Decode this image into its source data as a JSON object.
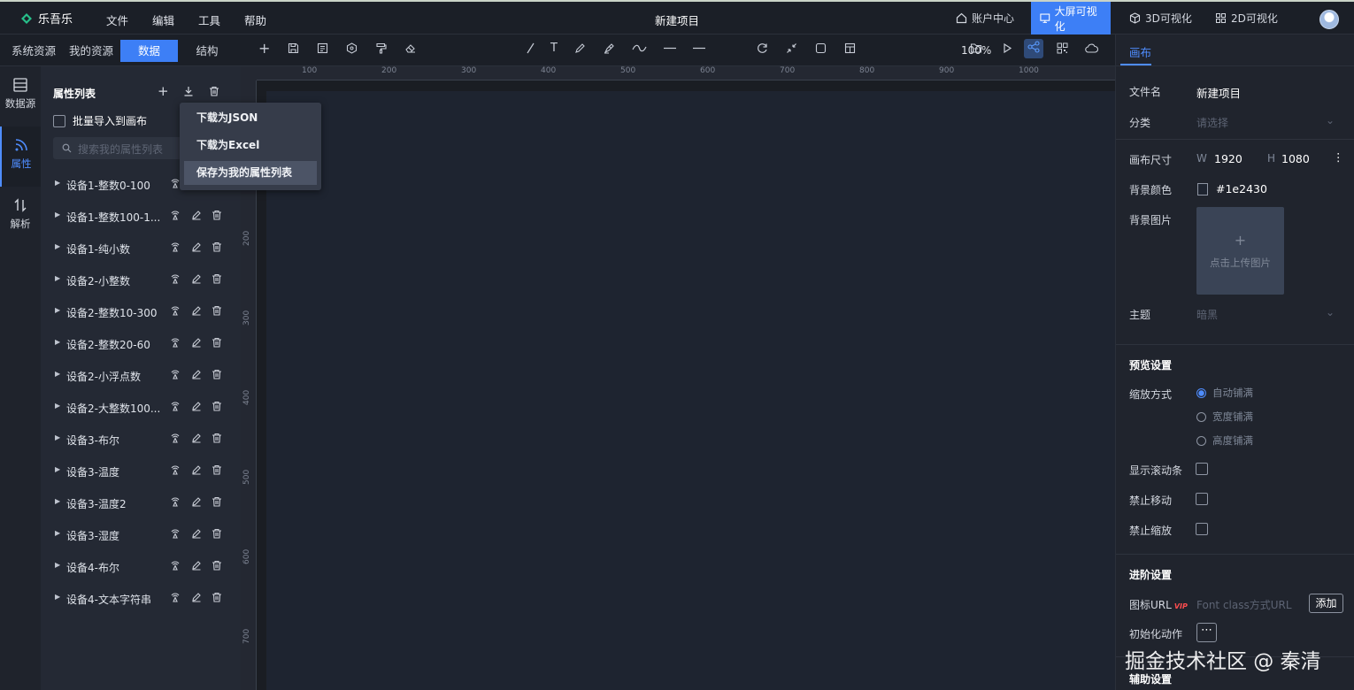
{
  "app": {
    "logo": "乐吾乐",
    "title": "新建项目"
  },
  "menu": [
    "文件",
    "编辑",
    "工具",
    "帮助"
  ],
  "nav_right": [
    "账户中心",
    "大屏可视化",
    "3D可视化",
    "2D可视化"
  ],
  "left_tabs": [
    "系统资源",
    "我的资源",
    "数据",
    "结构"
  ],
  "icon_tabs": [
    "数据源",
    "属性",
    "解析"
  ],
  "panel": {
    "title": "属性列表",
    "batch_import": "批量导入到画布",
    "search_placeholder": "搜索我的属性列表",
    "items": [
      "设备1-整数0-100",
      "设备1-整数100-1...",
      "设备1-纯小数",
      "设备2-小整数",
      "设备2-整数10-300",
      "设备2-整数20-60",
      "设备2-小浮点数",
      "设备2-大整数100...",
      "设备3-布尔",
      "设备3-温度",
      "设备3-温度2",
      "设备3-湿度",
      "设备4-布尔",
      "设备4-文本字符串"
    ]
  },
  "dropdown": [
    "下载为JSON",
    "下载为Excel",
    "保存为我的属性列表"
  ],
  "toolbar": {
    "zoom": "100%"
  },
  "ruler": {
    "top": [
      "100",
      "200",
      "300",
      "400",
      "500",
      "600",
      "700",
      "800",
      "900",
      "1000"
    ],
    "left": [
      "200",
      "300",
      "400",
      "500",
      "600",
      "700"
    ]
  },
  "right": {
    "tab": "画布",
    "file_name_label": "文件名",
    "file_name": "新建项目",
    "category_label": "分类",
    "category_placeholder": "请选择",
    "size_label": "画布尺寸",
    "w_label": "W",
    "w": "1920",
    "h_label": "H",
    "h": "1080",
    "bg_color_label": "背景颜色",
    "bg_color": "#1e2430",
    "bg_image_label": "背景图片",
    "upload_text": "点击上传图片",
    "theme_label": "主题",
    "theme": "暗黑",
    "preview_title": "预览设置",
    "scale_label": "缩放方式",
    "scale_options": [
      "自动铺满",
      "宽度铺满",
      "高度铺满"
    ],
    "show_scroll": "显示滚动条",
    "no_move": "禁止移动",
    "no_scale": "禁止缩放",
    "advanced_title": "进阶设置",
    "icon_url_label": "图标URL",
    "vip": "VIP",
    "icon_url_placeholder": "Font class方式URL",
    "add": "添加",
    "init_action_label": "初始化动作",
    "assist_title": "辅助设置"
  },
  "watermark": "掘金技术社区 @ 秦清"
}
